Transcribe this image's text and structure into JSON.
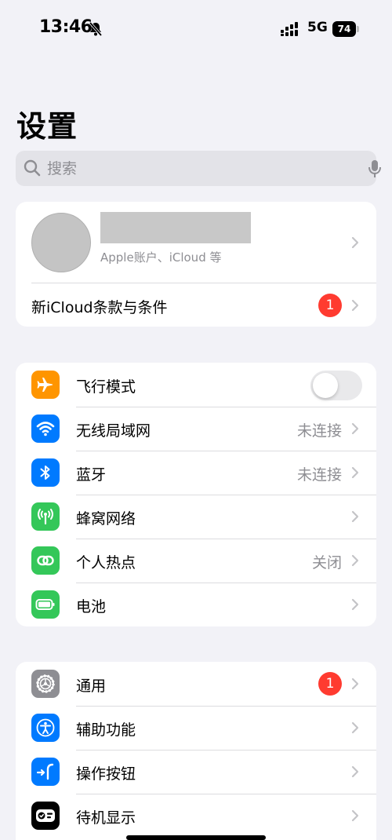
{
  "status_bar": {
    "time": "13:46",
    "network": "5G",
    "battery": "74"
  },
  "title": "设置",
  "search": {
    "placeholder": "搜索"
  },
  "profile": {
    "subtitle": "Apple账户、iCloud 等",
    "notice": "新iCloud条款与条件",
    "notice_badge": "1"
  },
  "connectivity": {
    "items": [
      {
        "label": "飞行模式",
        "icon": "airplane-icon",
        "color": "#ff9500",
        "toggle": false
      },
      {
        "label": "无线局域网",
        "icon": "wifi-icon",
        "color": "#007aff",
        "value": "未连接"
      },
      {
        "label": "蓝牙",
        "icon": "bluetooth-icon",
        "color": "#007aff",
        "value": "未连接"
      },
      {
        "label": "蜂窝网络",
        "icon": "cellular-icon",
        "color": "#34c759"
      },
      {
        "label": "个人热点",
        "icon": "hotspot-icon",
        "color": "#34c759",
        "value": "关闭"
      },
      {
        "label": "电池",
        "icon": "battery-icon",
        "color": "#34c759"
      }
    ]
  },
  "general": {
    "items": [
      {
        "label": "通用",
        "icon": "gear-icon",
        "color": "#8e8e93",
        "badge": "1"
      },
      {
        "label": "辅助功能",
        "icon": "accessibility-icon",
        "color": "#007aff"
      },
      {
        "label": "操作按钮",
        "icon": "action-button-icon",
        "color": "#007aff"
      },
      {
        "label": "待机显示",
        "icon": "standby-icon",
        "color": "#000000"
      }
    ]
  }
}
